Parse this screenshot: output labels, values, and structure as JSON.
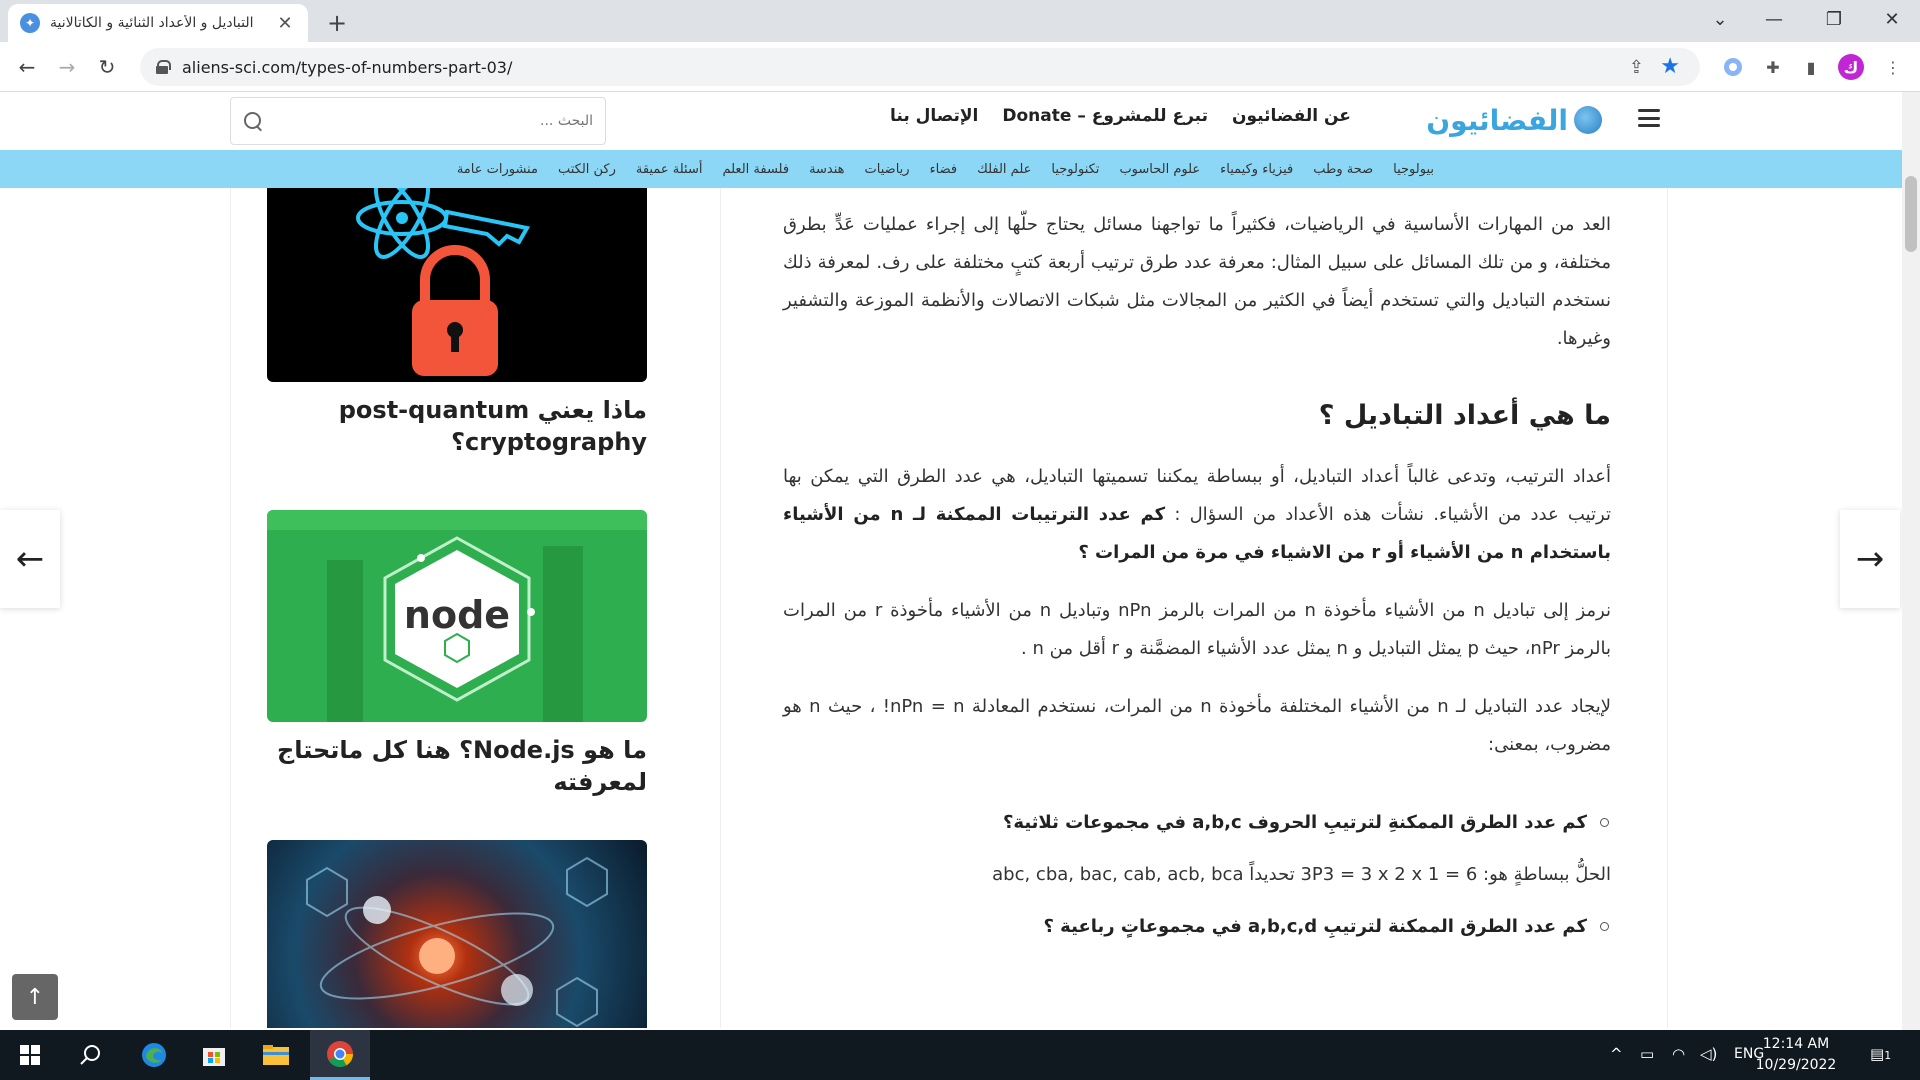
{
  "browser": {
    "tab_title": "التباديل و الأعداد الثنائية و الكاتالانية",
    "tab_close": "✕",
    "new_tab": "+",
    "url": "aliens-sci.com/types-of-numbers-part-03/",
    "profile_initial": "ك"
  },
  "site": {
    "logo_text": "الفضائيون",
    "nav": [
      "عن الفضائيون",
      "تبرع للمشروع – Donate",
      "الإتصال بنا"
    ],
    "search_placeholder": "البحث ...",
    "categories": [
      "بيولوجيا",
      "صحة وطب",
      "فيزياء وكيمياء",
      "علوم الحاسوب",
      "تكنولوجيا",
      "علم الفلك",
      "فضاء",
      "رياضيات",
      "هندسة",
      "فلسفة العلم",
      "أسئلة عميقة",
      "ركن الكتب",
      "منشورات عامة"
    ],
    "accent_color": "#8cd7f5",
    "logo_color": "#3ba6de"
  },
  "article": {
    "intro": "العد من المهارات الأساسية في الرياضيات، فكثيراً ما تواجهنا مسائل يحتاج حلّها إلى إجراء عمليات عَدٍّ بطرق مختلفة، و من تلك المسائل على سبيل المثال: معرفة عدد طرق ترتيب أربعة كتبٍ مختلفة على رف. لمعرفة ذلك نستخدم التباديل والتي تستخدم أيضاً في الكثير من المجالات مثل شبكات الاتصالات والأنظمة الموزعة والتشفير وغيرها.",
    "heading": "ما هي أعداد التباديل ؟",
    "def_p1": "أعداد الترتيب، وتدعى غالباً أعداد التباديل، أو ببساطة يمكننا تسميتها التباديل، هي عدد الطرق التي يمكن بها ترتيب عدد من الأشياء. نشأت هذه الأعداد من السؤال :",
    "def_p1_bold": "كم عدد الترتيبات الممكنة لـ n من الأشياء باستخدام n من الأشياء أو r من الاشياء في مرة من المرات ؟",
    "notation": "نرمز إلى تباديل n من الأشياء مأخوذة n من المرات بالرمز nPn وتباديل n من الأشياء مأخوذة r من المرات بالرمز nPr، حيث p يمثل التباديل و n يمثل عدد الأشياء المضمَّنة و r أقل من n .",
    "formula_p": "لإيجاد عدد التباديل لـ n من الأشياء المختلفة مأخوذة n من المرات، نستخدم المعادلة nPn = n! ، حيث n هو مضروب، بمعنى:",
    "q1": "كم عدد الطرق الممكنةِ لترتيبِ الحروف a,b,c في مجموعات ثلاثية؟",
    "a1": "الحلُّ ببساطةٍ هو: 3P3 = 3 x 2 x 1 = 6 تحديداً abc, cba, bac, cab, acb, bca",
    "q2": "كم عدد الطرق الممكنة لترتيبِ a,b,c,d في مجموعاتٍ رباعية ؟"
  },
  "sidebar": {
    "cards": [
      {
        "title": "ماذا يعني post-quantum cryptography؟",
        "thumb_icon": "lock-key-atom-icon"
      },
      {
        "title": "ما هو Node.js؟ هنا كل ماتحتاج لمعرفته",
        "thumb_icon": "nodejs-logo-icon"
      },
      {
        "title": "",
        "thumb_icon": "atom-molecules-icon"
      }
    ]
  },
  "nav_arrows": {
    "prev": "←",
    "next": "→",
    "to_top": "↑"
  },
  "taskbar": {
    "lang": "ENG",
    "time": "12:14 AM",
    "date": "10/29/2022",
    "notif_count": "1"
  }
}
